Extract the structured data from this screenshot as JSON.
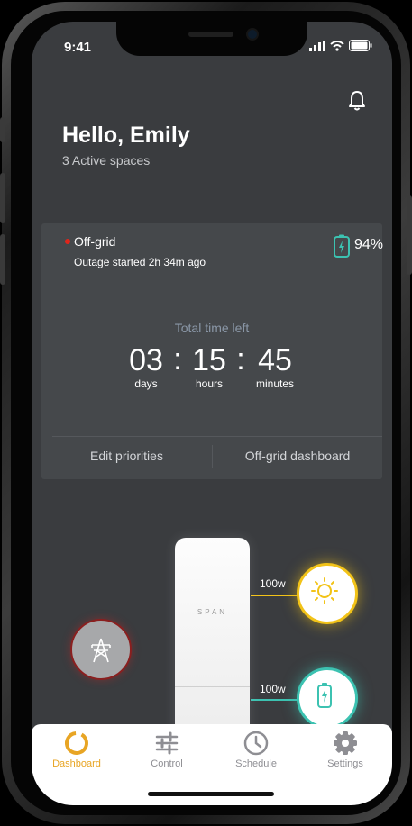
{
  "status_bar": {
    "time": "9:41"
  },
  "header": {
    "greeting": "Hello, Emily",
    "subtitle": "3 Active spaces"
  },
  "outage_card": {
    "status": "Off-grid",
    "outage_text": "Outage started 2h 34m ago",
    "battery_percent": "94%",
    "total_label": "Total time left",
    "days": "03",
    "days_unit": "days",
    "hours": "15",
    "hours_unit": "hours",
    "minutes": "45",
    "minutes_unit": "minutes",
    "edit_priorities": "Edit priorities",
    "offgrid_dashboard": "Off-grid dashboard"
  },
  "energy_flow": {
    "panel_logo": "SPAN",
    "solar_watts": "100w",
    "battery_watts": "100w",
    "colors": {
      "solar": "#f2c318",
      "battery": "#3cc2b1",
      "grid_alert": "#8a1f1f"
    }
  },
  "tabbar": {
    "items": [
      {
        "label": "Dashboard",
        "icon": "ring-icon",
        "active": true
      },
      {
        "label": "Control",
        "icon": "sliders-icon",
        "active": false
      },
      {
        "label": "Schedule",
        "icon": "clock-icon",
        "active": false
      },
      {
        "label": "Settings",
        "icon": "gear-icon",
        "active": false
      }
    ]
  },
  "accent_color": "#e8a524"
}
